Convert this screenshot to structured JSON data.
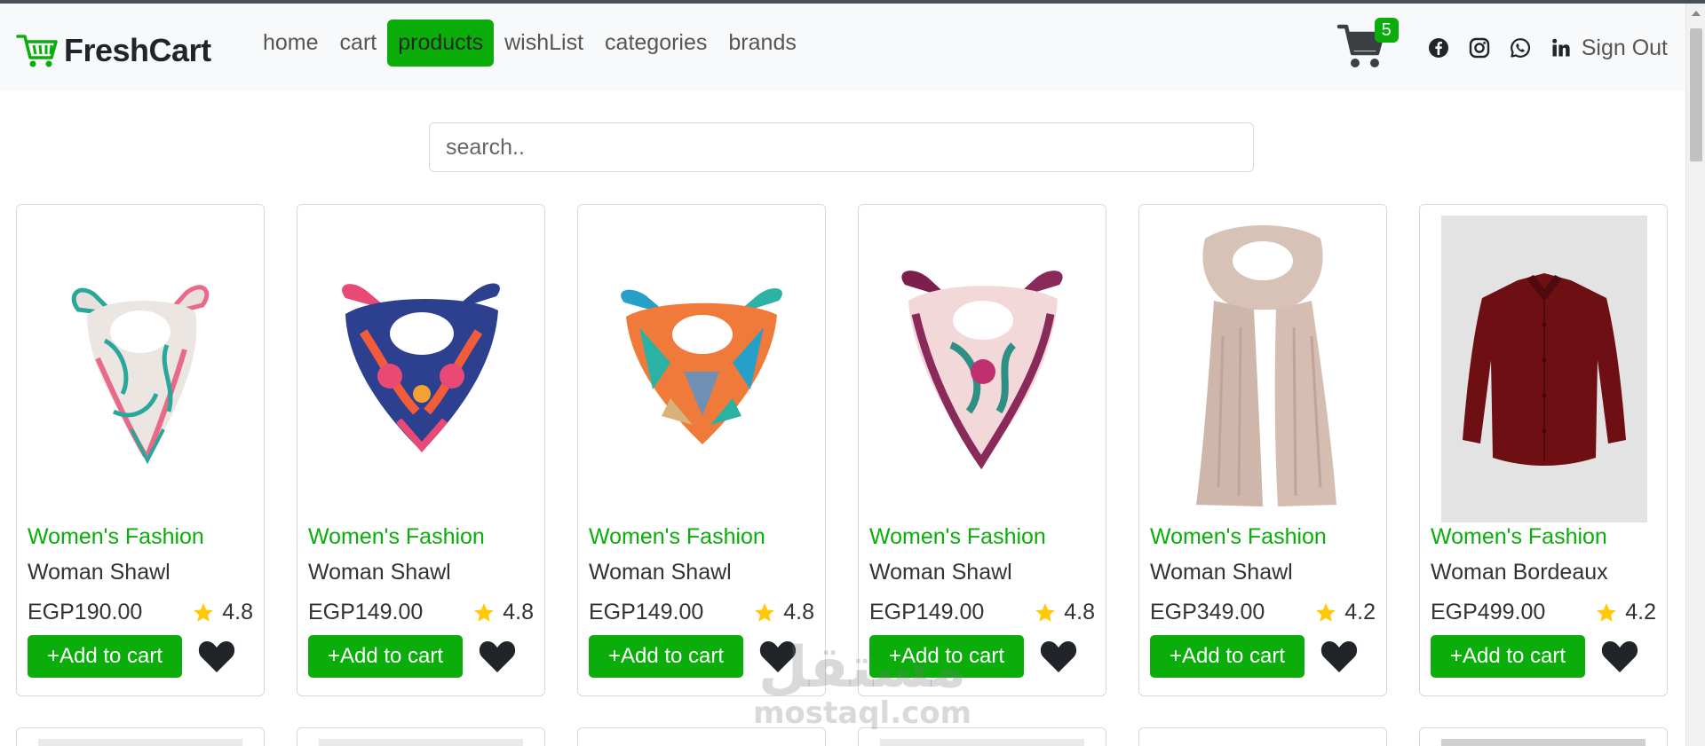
{
  "brand": {
    "name": "FreshCart",
    "icon": "cart-icon"
  },
  "nav": {
    "links": [
      {
        "label": "home"
      },
      {
        "label": "cart"
      },
      {
        "label": "products",
        "active": true
      },
      {
        "label": "wishList"
      },
      {
        "label": "categories"
      },
      {
        "label": "brands"
      }
    ],
    "cart_count": "5",
    "socials": [
      "facebook-icon",
      "instagram-icon",
      "whatsapp-icon",
      "linkedin-icon"
    ],
    "signout": "Sign Out"
  },
  "search": {
    "placeholder": "search.."
  },
  "colors": {
    "accent": "#0aad0a",
    "star": "#ffc908",
    "heart": "#212529"
  },
  "products": [
    {
      "category": "Women's Fashion",
      "title": "Woman Shawl",
      "price": "EGP190.00",
      "rating": "4.8",
      "button": "+Add to cart",
      "image": "scarf-white-green"
    },
    {
      "category": "Women's Fashion",
      "title": "Woman Shawl",
      "price": "EGP149.00",
      "rating": "4.8",
      "button": "+Add to cart",
      "image": "scarf-navy-pink"
    },
    {
      "category": "Women's Fashion",
      "title": "Woman Shawl",
      "price": "EGP149.00",
      "rating": "4.8",
      "button": "+Add to cart",
      "image": "scarf-orange-teal"
    },
    {
      "category": "Women's Fashion",
      "title": "Woman Shawl",
      "price": "EGP149.00",
      "rating": "4.8",
      "button": "+Add to cart",
      "image": "scarf-pink-plum"
    },
    {
      "category": "Women's Fashion",
      "title": "Woman Shawl",
      "price": "EGP349.00",
      "rating": "4.2",
      "button": "+Add to cart",
      "image": "long-scarf-beige"
    },
    {
      "category": "Women's Fashion",
      "title": "Woman Bordeaux",
      "price": "EGP499.00",
      "rating": "4.2",
      "button": "+Add to cart",
      "image": "shirt-bordeaux"
    }
  ],
  "watermark": {
    "arabic": "مستقل",
    "latin": "mostaql.com"
  }
}
